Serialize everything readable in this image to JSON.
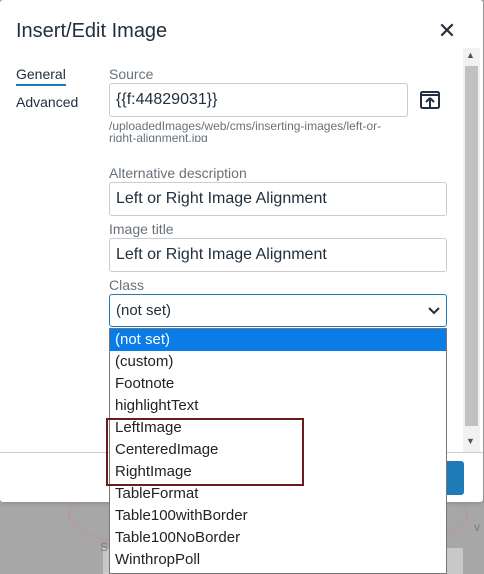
{
  "dialog": {
    "title": "Insert/Edit Image",
    "close_icon": "close-icon"
  },
  "tabs": [
    {
      "label": "General",
      "active": true
    },
    {
      "label": "Advanced",
      "active": false
    }
  ],
  "source": {
    "label": "Source",
    "value": "{{f:44829031}}",
    "path_line1": "/uploadedImages/web/cms/inserting-images/left-or-",
    "path_line2": "right-alignment.jpg",
    "browse_icon": "browse-icon"
  },
  "alt": {
    "label": "Alternative description",
    "value": "Left or Right Image Alignment"
  },
  "image_title": {
    "label": "Image title",
    "value": "Left or Right Image Alignment"
  },
  "class_select": {
    "label": "Class",
    "selected": "(not set)",
    "options": [
      "(not set)",
      "(custom)",
      "Footnote",
      "highlightText",
      "LeftImage",
      "CenteredImage",
      "RightImage",
      "TableFormat",
      "Table100withBorder",
      "Table100NoBorder",
      "WinthropPoll"
    ]
  },
  "colors": {
    "accent": "#207ab7",
    "selected_option": "#0a7ce8",
    "highlight_box": "#6b1b1b"
  }
}
